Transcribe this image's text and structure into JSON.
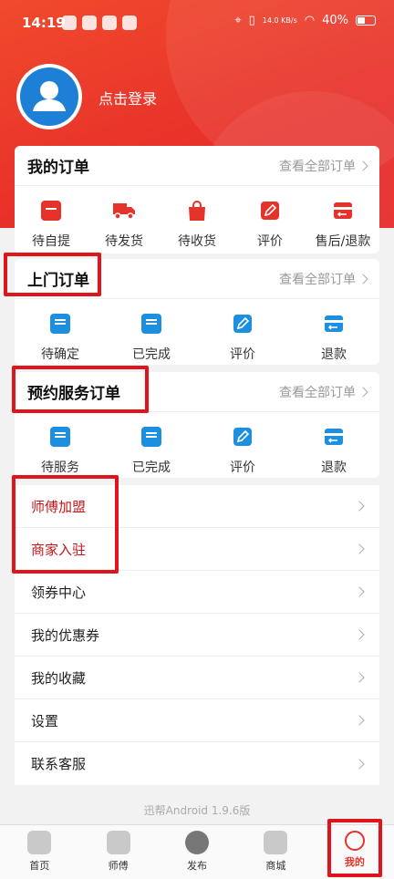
{
  "status": {
    "time": "14:19",
    "net_speed": "14.0\nKB/s",
    "battery": "40%"
  },
  "profile": {
    "login_label": "点击登录"
  },
  "orders": {
    "title": "我的订单",
    "view_all": "查看全部订单",
    "items": [
      "待自提",
      "待发货",
      "待收货",
      "评价",
      "售后/退款"
    ]
  },
  "home_orders": {
    "title": "上门订单",
    "view_all": "查看全部订单",
    "items": [
      "待确定",
      "已完成",
      "评价",
      "退款"
    ]
  },
  "service_orders": {
    "title": "预约服务订单",
    "view_all": "查看全部订单",
    "items": [
      "待服务",
      "已完成",
      "评价",
      "退款"
    ]
  },
  "menu": [
    {
      "label": "师傅加盟"
    },
    {
      "label": "商家入驻"
    },
    {
      "label": "领券中心"
    },
    {
      "label": "我的优惠券"
    },
    {
      "label": "我的收藏"
    },
    {
      "label": "设置"
    },
    {
      "label": "联系客服"
    }
  ],
  "version": "迅帮Android 1.9.6版",
  "tabs": [
    "首页",
    "师傅",
    "发布",
    "商城",
    "我的"
  ],
  "colors": {
    "accent": "#e5322b",
    "blue": "#1d8fe0",
    "highlight": "#e0141b"
  }
}
